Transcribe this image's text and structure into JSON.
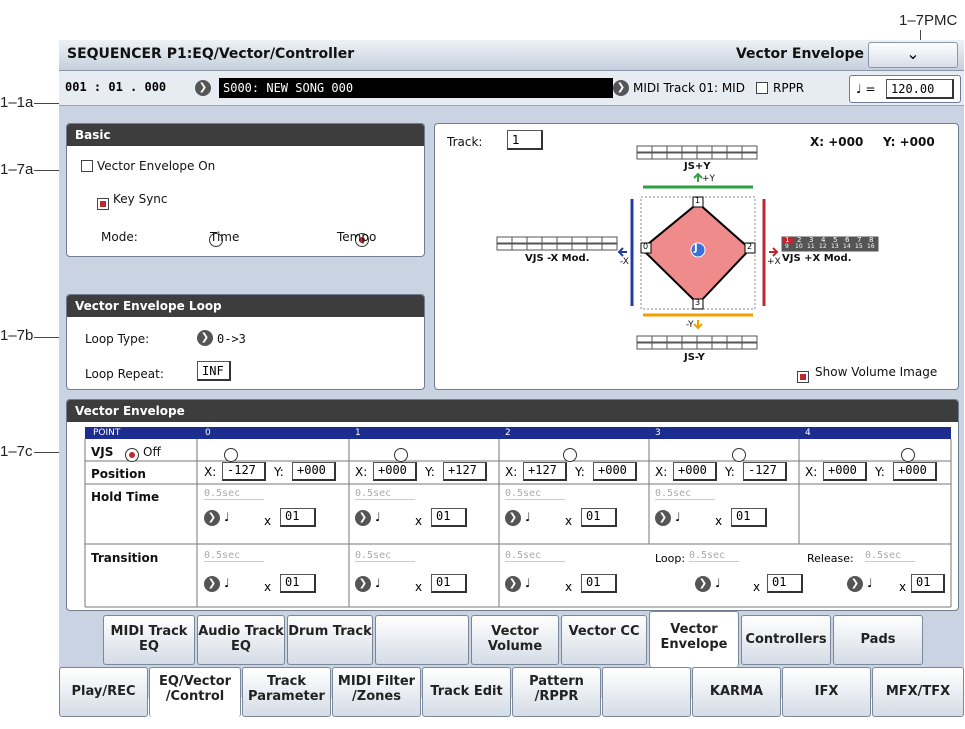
{
  "callouts": {
    "c17pmc": "1–7PMC",
    "c11a": "1–1a",
    "c17a": "1–7a",
    "c17b": "1–7b",
    "c17c": "1–7c"
  },
  "title": "SEQUENCER P1:EQ/Vector/Controller",
  "page_name": "Vector Envelope",
  "menu_icon": "chevron-down-icon",
  "location": "001 : 01 . 000",
  "song": "S000: NEW SONG 000",
  "midi_track": "MIDI Track 01: MID",
  "rppr_label": "RPPR",
  "tempo_symbol": "♩ =",
  "tempo": "120.00",
  "basic": {
    "heading": "Basic",
    "vector_env_on": "Vector Envelope On",
    "key_sync": "Key Sync",
    "mode_label": "Mode:",
    "mode_time": "Time",
    "mode_tempo": "Tempo"
  },
  "loop": {
    "heading": "Vector Envelope Loop",
    "type_label": "Loop Type:",
    "type_value": "0->3",
    "repeat_label": "Loop Repeat:",
    "repeat_value": "INF"
  },
  "display": {
    "track_label": "Track:",
    "track_value": "1",
    "x_readout": "X: +000",
    "y_readout": "Y: +000",
    "js_plus_y": "JS+Y",
    "plus_y": "+Y",
    "js_minus_y": "JS-Y",
    "minus_y": "-Y",
    "vjs_minus_x": "VJS -X Mod.",
    "minus_x": "-X",
    "vjs_plus_x": "VJS +X Mod.",
    "plus_x": "+X",
    "pt0": "0",
    "pt1": "1",
    "pt2": "2",
    "pt3": "3",
    "center": "J",
    "show_volume": "Show Volume Image",
    "track_nums_top": [
      "1",
      "2",
      "3",
      "4",
      "5",
      "6",
      "7",
      "8"
    ],
    "track_nums_bot": [
      "9",
      "10",
      "11",
      "12",
      "13",
      "14",
      "15",
      "16"
    ]
  },
  "venv": {
    "heading": "Vector Envelope",
    "point_label": "POINT",
    "vjs": "VJS",
    "off": "Off",
    "position": "Position",
    "hold_time": "Hold Time",
    "transition": "Transition",
    "points": [
      "0",
      "1",
      "2",
      "3",
      "4"
    ],
    "pos": [
      [
        "-127",
        "+000"
      ],
      [
        "+000",
        "+127"
      ],
      [
        "+127",
        "+000"
      ],
      [
        "+000",
        "-127"
      ],
      [
        "+000",
        "+000"
      ]
    ],
    "sec": "0.5sec",
    "note": "♩",
    "times": "x",
    "mult": "01",
    "loop_label": "Loop:",
    "release_label": "Release:"
  },
  "tabs_top": [
    "MIDI Track EQ",
    "Audio Track EQ",
    "Drum Track",
    "",
    "Vector Volume",
    "Vector CC",
    "Vector Envelope",
    "Controllers",
    "Pads"
  ],
  "tabs_bottom": [
    "Play/REC",
    "EQ/Vector /Control",
    "Track Parameter",
    "MIDI Filter /Zones",
    "Track Edit",
    "Pattern /RPPR",
    "",
    "KARMA",
    "IFX",
    "MFX/TFX"
  ]
}
